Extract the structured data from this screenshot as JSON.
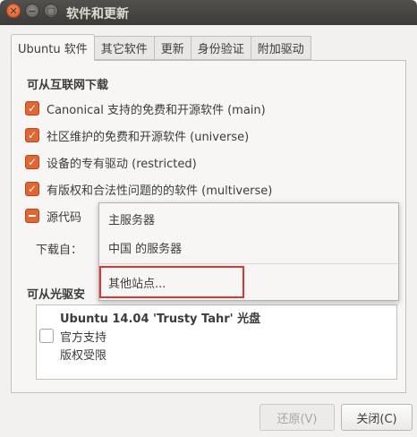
{
  "window": {
    "title": "软件和更新",
    "close_glyph": "✕",
    "min_glyph": "−",
    "max_glyph": "□"
  },
  "tabs": [
    {
      "label": "Ubuntu 软件",
      "active": true
    },
    {
      "label": "其它软件",
      "active": false
    },
    {
      "label": "更新",
      "active": false
    },
    {
      "label": "身份验证",
      "active": false
    },
    {
      "label": "附加驱动",
      "active": false
    }
  ],
  "internet": {
    "title": "可从互联网下载",
    "items": [
      {
        "label": "Canonical 支持的免费和开源软件 (main)",
        "state": "checked"
      },
      {
        "label": "社区维护的免费和开源软件 (universe)",
        "state": "checked"
      },
      {
        "label": "设备的专有驱动 (restricted)",
        "state": "checked"
      },
      {
        "label": "有版权和合法性问题的的软件 (multiverse)",
        "state": "checked"
      },
      {
        "label": "源代码",
        "state": "partial"
      }
    ],
    "download_from_label": "下载自："
  },
  "cdrom": {
    "title": "可从光驱安",
    "disc_title": "Ubuntu 14.04 'Trusty Tahr' 光盘",
    "disc_lines": [
      "官方支持",
      "版权受限"
    ],
    "disc_checked": false
  },
  "dropdown": {
    "items": [
      "主服务器",
      "中国 的服务器"
    ],
    "other": "其他站点..."
  },
  "buttons": {
    "revert": "还原(V)",
    "close": "关闭(C)"
  },
  "colors": {
    "accent_checkbox": "#e26632",
    "highlight_border": "#e03535",
    "titlebar": "#3c3b37"
  }
}
